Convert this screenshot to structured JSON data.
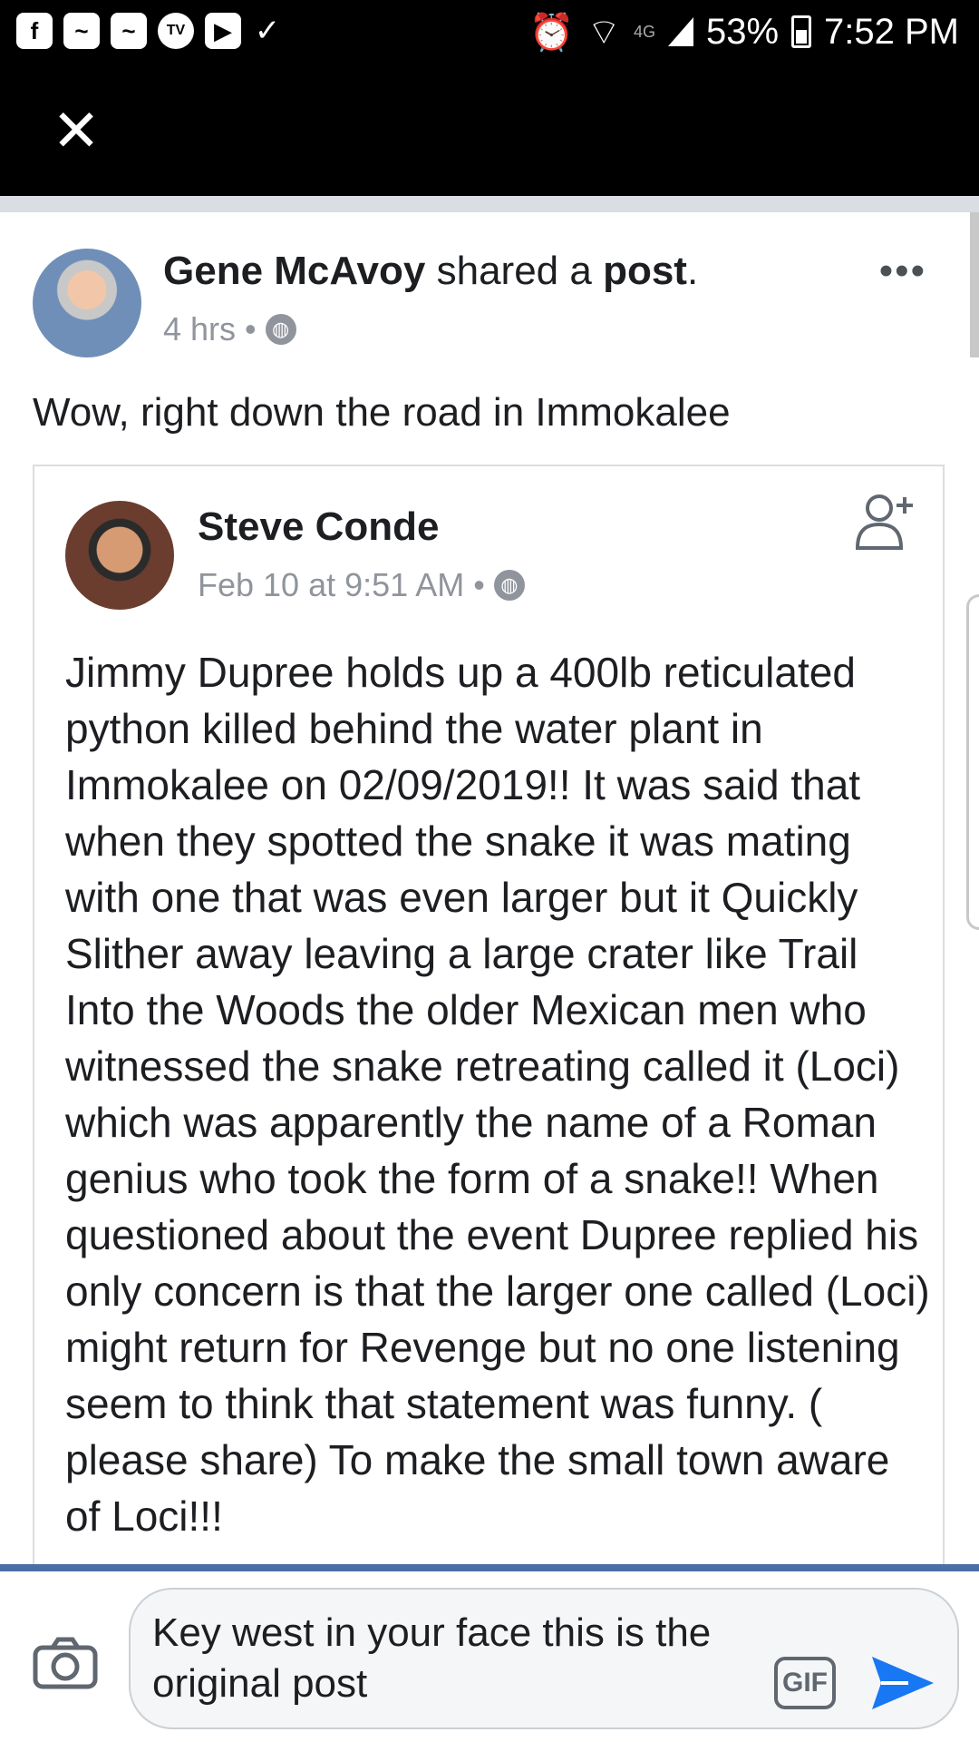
{
  "status_bar": {
    "apps": [
      "f",
      "~",
      "~",
      "TV",
      "▶",
      "✓"
    ],
    "network": "4G",
    "battery": "53%",
    "time": "7:52 PM"
  },
  "header": {
    "close_icon": "✕"
  },
  "post": {
    "author": "Gene McAvoy",
    "action_pre": "shared a",
    "action_obj": "post",
    "action_end": ".",
    "time": "4 hrs",
    "separator": "•",
    "more": "•••",
    "text": "Wow, right down the road in Immokalee"
  },
  "shared": {
    "author": "Steve Conde",
    "date": "Feb 10 at 9:51 AM",
    "separator": "•",
    "body": "Jimmy Dupree holds up a 400lb reticulated python killed behind the water plant in Immokalee on 02/09/2019!! It was said that when they spotted the snake it was mating with one that was even larger but it Quickly Slither away leaving a large crater like Trail Into the Woods the older Mexican men who witnessed the snake retreating called it (Loci) which was apparently the name of a Roman genius who took the form of a snake!! When questioned about the event Dupree replied his only concern is that the larger one called (Loci) might return for Revenge but no one listening seem to think that statement was funny. ( please share) To make the small town aware of Loci!!!"
  },
  "composer": {
    "input_value": "Key west in your face this is the original post",
    "gif_label": "GIF"
  },
  "colors": {
    "accent": "#1877f2",
    "meta_gray": "#90949c",
    "divider": "#dadde1",
    "bar_blue": "#4a6fa5"
  }
}
